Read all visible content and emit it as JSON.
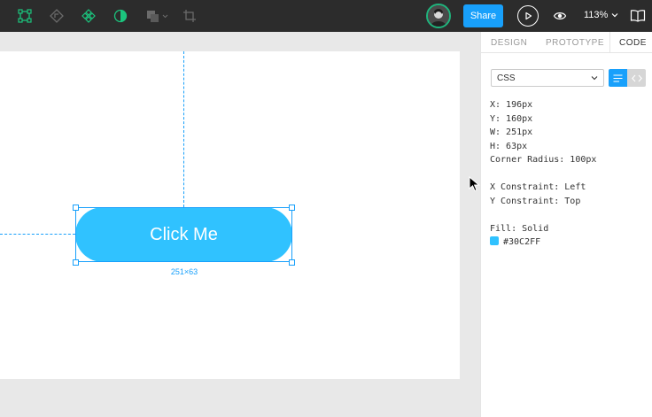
{
  "topbar": {
    "tools": [
      {
        "icon": "frame-icon"
      },
      {
        "icon": "component-back-icon"
      },
      {
        "icon": "component-icon"
      },
      {
        "icon": "mask-icon"
      },
      {
        "icon": "boolean-icon"
      },
      {
        "icon": "crop-icon"
      }
    ],
    "share_label": "Share",
    "zoom_label": "113%"
  },
  "canvas": {
    "button_label": "Click Me",
    "dims_label": "251×63",
    "button_fill": "#30C2FF",
    "selection_color": "#18A0FB"
  },
  "panel": {
    "tabs": [
      {
        "label": "DESIGN"
      },
      {
        "label": "PROTOTYPE"
      },
      {
        "label": "CODE"
      }
    ],
    "language": "CSS",
    "code_lines": [
      "X: 196px",
      "Y: 160px",
      "W: 251px",
      "H: 63px",
      "Corner Radius: 100px",
      "",
      "X Constraint: Left",
      "Y Constraint: Top",
      "",
      "Fill: Solid"
    ],
    "fill_hex": "#30C2FF"
  }
}
